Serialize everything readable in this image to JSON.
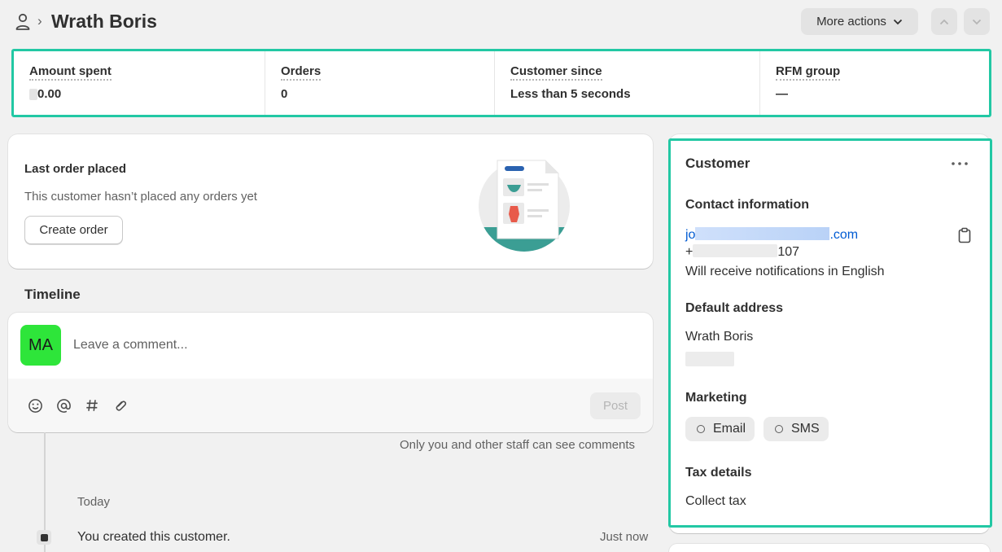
{
  "header": {
    "title": "Wrath Boris",
    "breadcrumb_sep": "›",
    "more_actions_label": "More actions"
  },
  "stats": [
    {
      "label": "Amount spent",
      "value_prefix": "",
      "value": "0.00"
    },
    {
      "label": "Orders",
      "value": "0"
    },
    {
      "label": "Customer since",
      "value": "Less than 5 seconds"
    },
    {
      "label": "RFM group",
      "value": "—"
    }
  ],
  "last_order": {
    "title": "Last order placed",
    "text": "This customer hasn’t placed any orders yet",
    "button": "Create order"
  },
  "timeline": {
    "title": "Timeline",
    "avatar_initials": "MA",
    "comment_placeholder": "Leave a comment...",
    "post_label": "Post",
    "note": "Only you and other staff can see comments",
    "date_label": "Today",
    "events": [
      {
        "text": "You created this customer.",
        "time": "Just now"
      }
    ]
  },
  "customer": {
    "title": "Customer",
    "contact_heading": "Contact information",
    "email_start": "jo",
    "email_end": ".com",
    "phone_start": "+",
    "phone_end": "107",
    "notifications": "Will receive notifications in English",
    "address_heading": "Default address",
    "address_name": "Wrath Boris",
    "marketing_heading": "Marketing",
    "marketing_email": "Email",
    "marketing_sms": "SMS",
    "tax_heading": "Tax details",
    "tax_value": "Collect tax"
  },
  "colors": {
    "highlight": "#22c8a4",
    "avatar": "#2ee53a",
    "link": "#005bd3"
  }
}
